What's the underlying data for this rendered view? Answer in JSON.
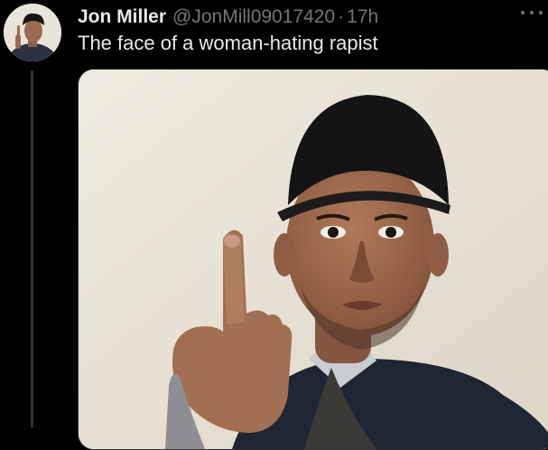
{
  "tweet": {
    "author": {
      "display_name": "Jon Miller",
      "handle": "@JonMill09017420",
      "avatar_icon": "profile-photo-avatar"
    },
    "separator": "·",
    "timestamp": "17h",
    "text": "The face of a woman-hating rapist",
    "more_icon": "more-horizontal-icon",
    "media": {
      "type": "photo",
      "alt_description_icon": "selfie-photo"
    }
  },
  "colors": {
    "background": "#000000",
    "primary_text": "#e7e9ea",
    "secondary_text": "#71767b",
    "thread_line": "#333639"
  }
}
